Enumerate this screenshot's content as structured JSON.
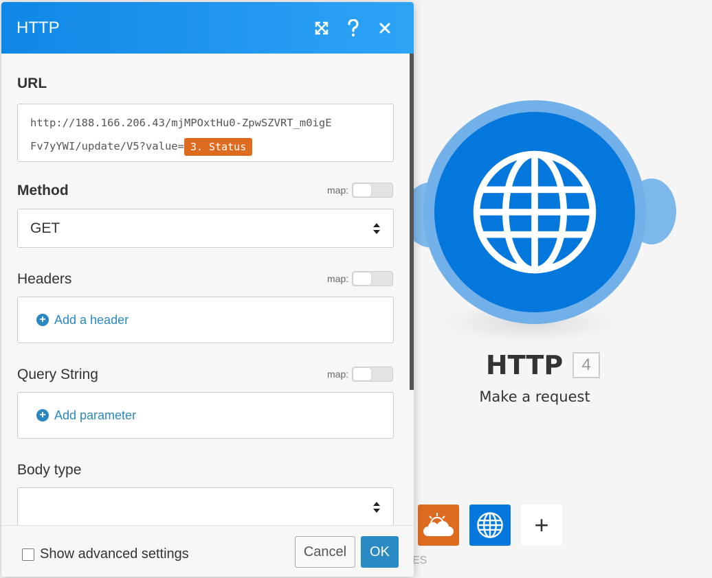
{
  "dialog": {
    "title": "HTTP",
    "header_icons": [
      "expand-icon",
      "help-icon",
      "close-icon"
    ],
    "fields": {
      "url": {
        "label": "URL",
        "value_line1": "http://188.166.206.43/mjMPOxtHu0-ZpwSZVRT_m0igE",
        "value_line2": "Fv7yYWI/update/V5?value=",
        "mapped_pill": "3. Status"
      },
      "method": {
        "label": "Method",
        "map_label": "map:",
        "value": "GET"
      },
      "headers": {
        "label": "Headers",
        "map_label": "map:",
        "add_label": "Add a header"
      },
      "query_string": {
        "label": "Query String",
        "map_label": "map:",
        "add_label": "Add parameter"
      },
      "body_type": {
        "label": "Body type",
        "value": ""
      }
    },
    "footer": {
      "advanced_label": "Show advanced settings",
      "cancel_label": "Cancel",
      "ok_label": "OK"
    }
  },
  "module": {
    "name": "HTTP",
    "badge": "4",
    "subtitle": "Make a request",
    "icon": "globe-icon"
  },
  "tray": {
    "items": [
      "weather-icon",
      "globe-icon",
      "plus-icon"
    ],
    "add_label": "+",
    "caption": "ES"
  },
  "colors": {
    "header_blue": "#1a93ee",
    "module_blue": "#0377dc",
    "module_ring": "#72b0ea",
    "pill_orange": "#dd6b20",
    "link_blue": "#2b87c0",
    "ok_blue": "#2a8bc4"
  }
}
